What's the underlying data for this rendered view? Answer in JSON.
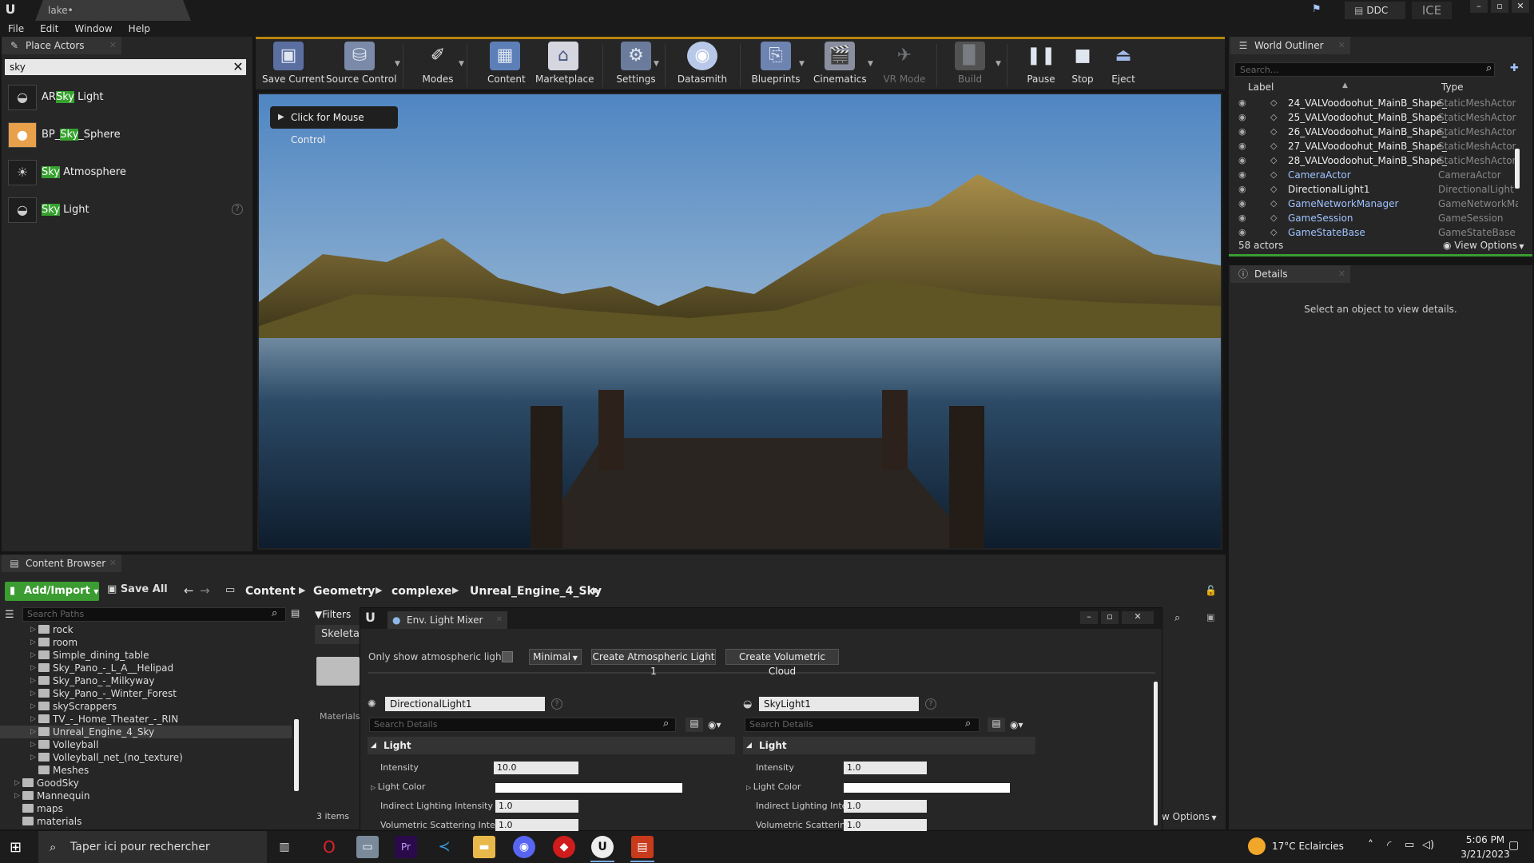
{
  "window": {
    "logo": "U",
    "doc_tab": "lake•",
    "ddc": "DDC",
    "ice": "ICE",
    "ctrls": [
      "–",
      "▫",
      "✕"
    ]
  },
  "menu": [
    "File",
    "Edit",
    "Window",
    "Help"
  ],
  "place_actors": {
    "tab": "Place Actors",
    "search_value": "sky",
    "items": [
      {
        "pre": "AR",
        "hl": "Sky",
        "post": " Light"
      },
      {
        "pre": "BP_",
        "hl": "Sky",
        "post": "_Sphere"
      },
      {
        "pre": "",
        "hl": "Sky",
        "post": " Atmosphere"
      },
      {
        "pre": "",
        "hl": "Sky",
        "post": " Light"
      }
    ]
  },
  "toolbar": {
    "buttons": [
      "Save Current",
      "Source Control",
      "Modes",
      "Content",
      "Marketplace",
      "Settings",
      "Datasmith",
      "Blueprints",
      "Cinematics",
      "VR Mode",
      "Build",
      "Pause",
      "Stop",
      "Eject"
    ]
  },
  "viewport": {
    "mouse_control": "Click for Mouse Control"
  },
  "world_outliner": {
    "tab": "World Outliner",
    "search_placeholder": "Search...",
    "col_label": "Label",
    "col_type": "Type",
    "rows": [
      {
        "label": "24_VALVoodoohut_MainB_Shape_",
        "type": "StaticMeshActor",
        "blue": false
      },
      {
        "label": "25_VALVoodoohut_MainB_Shape_",
        "type": "StaticMeshActor",
        "blue": false
      },
      {
        "label": "26_VALVoodoohut_MainB_Shape_",
        "type": "StaticMeshActor",
        "blue": false
      },
      {
        "label": "27_VALVoodoohut_MainB_Shape_",
        "type": "StaticMeshActor",
        "blue": false
      },
      {
        "label": "28_VALVoodoohut_MainB_Shape_",
        "type": "StaticMeshActor",
        "blue": false
      },
      {
        "label": "CameraActor",
        "type": "CameraActor",
        "blue": true
      },
      {
        "label": "DirectionalLight1",
        "type": "DirectionalLight",
        "blue": false
      },
      {
        "label": "GameNetworkManager",
        "type": "GameNetworkMar",
        "blue": true
      },
      {
        "label": "GameSession",
        "type": "GameSession",
        "blue": true
      },
      {
        "label": "GameStateBase",
        "type": "GameStateBase",
        "blue": true
      }
    ],
    "count": "58 actors",
    "view_options": "View Options"
  },
  "details": {
    "tab": "Details",
    "empty": "Select an object to view details."
  },
  "content_browser": {
    "tab": "Content Browser",
    "add_import": "Add/Import",
    "save_all": "Save All",
    "crumbs": [
      "Content",
      "Geometry",
      "complexe",
      "Unreal_Engine_4_Sky"
    ],
    "search_paths": "Search Paths",
    "filters": "Filters",
    "skeleta": "Skeleta",
    "materials_label": "Materials",
    "items_count": "3 items",
    "view_options": "w Options",
    "tree": [
      {
        "label": "rock",
        "indent": 1,
        "exp": true
      },
      {
        "label": "room",
        "indent": 1,
        "exp": true
      },
      {
        "label": "Simple_dining_table",
        "indent": 1,
        "exp": true
      },
      {
        "label": "Sky_Pano_-_L_A__Helipad",
        "indent": 1,
        "exp": true
      },
      {
        "label": "Sky_Pano_-_Milkyway",
        "indent": 1,
        "exp": true
      },
      {
        "label": "Sky_Pano_-_Winter_Forest",
        "indent": 1,
        "exp": true
      },
      {
        "label": "skyScrappers",
        "indent": 1,
        "exp": true
      },
      {
        "label": "TV_-_Home_Theater_-_RIN",
        "indent": 1,
        "exp": true
      },
      {
        "label": "Unreal_Engine_4_Sky",
        "indent": 1,
        "exp": true,
        "selected": true
      },
      {
        "label": "Volleyball",
        "indent": 1,
        "exp": true
      },
      {
        "label": "Volleyball_net_(no_texture)",
        "indent": 1,
        "exp": true
      },
      {
        "label": "Meshes",
        "indent": 1,
        "exp": false
      },
      {
        "label": "GoodSky",
        "indent": 0,
        "exp": true
      },
      {
        "label": "Mannequin",
        "indent": 0,
        "exp": true
      },
      {
        "label": "maps",
        "indent": 0,
        "exp": false
      },
      {
        "label": "materials",
        "indent": 0,
        "exp": false
      }
    ]
  },
  "env_light_mixer": {
    "tab": "Env. Light Mixer",
    "only_atmos": "Only show atmospheric lights",
    "minimal": "Minimal",
    "create_atmos": "Create Atmospheric Light 1",
    "create_cloud": "Create Volumetric Cloud",
    "left": {
      "name": "DirectionalLight1",
      "search": "Search Details",
      "section": "Light",
      "intensity_label": "Intensity",
      "intensity": "10.0",
      "color_label": "Light Color",
      "indirect_label": "Indirect Lighting Intensity",
      "indirect": "1.0",
      "vol_label": "Volumetric Scattering Inten",
      "vol": "1.0"
    },
    "right": {
      "name": "SkyLight1",
      "search": "Search Details",
      "section": "Light",
      "intensity_label": "Intensity",
      "intensity": "1.0",
      "color_label": "Light Color",
      "indirect_label": "Indirect Lighting Inter",
      "indirect": "1.0",
      "vol_label": "Volumetric Scatterinc",
      "vol": "1.0"
    }
  },
  "taskbar": {
    "search": "Taper ici pour rechercher",
    "weather": "17°C  Eclaircies",
    "time": "5:06 PM",
    "date": "3/21/2023"
  }
}
